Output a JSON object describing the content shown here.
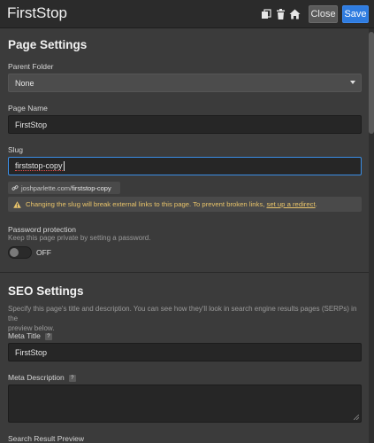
{
  "header": {
    "title": "FirstStop",
    "close_label": "Close",
    "save_label": "Save",
    "icons": [
      "copy-icon",
      "trash-icon",
      "home-icon"
    ]
  },
  "page_settings": {
    "title": "Page Settings",
    "parent_folder": {
      "label": "Parent Folder",
      "value": "None"
    },
    "page_name": {
      "label": "Page Name",
      "value": "FirstStop"
    },
    "slug": {
      "label": "Slug",
      "value": "firststop-copy",
      "url_base": "joshparlette.com/",
      "url_slug": "firststop-copy"
    },
    "warning": {
      "text": "Changing the slug will break external links to this page. To prevent broken links,",
      "link": "set up a redirect",
      "end": "."
    },
    "password": {
      "label": "Password protection",
      "helper": "Keep this page private by setting a password.",
      "state": "OFF"
    }
  },
  "seo_settings": {
    "title": "SEO Settings",
    "description_line1": "Specify this page's title and description. You can see how they'll look in search engine results pages (SERPs) in the",
    "description_line2": "preview below.",
    "meta_title": {
      "label": "Meta Title",
      "help": "?",
      "value": "FirstStop"
    },
    "meta_description": {
      "label": "Meta Description",
      "help": "?",
      "value": ""
    },
    "search_preview_label": "Search Result Preview"
  },
  "colors": {
    "accent": "#2f7ce0",
    "warning_text": "#e9c46a",
    "background": "#3b3b3b"
  }
}
